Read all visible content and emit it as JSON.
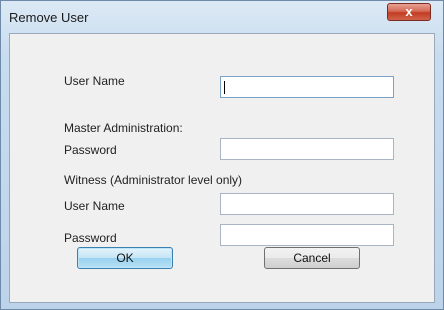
{
  "window": {
    "title": "Remove User",
    "close_glyph": "x"
  },
  "form": {
    "user_name_label": "User Name",
    "user_name_value": "",
    "master_section_label": "Master Administration:",
    "master_password_label": "Password",
    "master_password_value": "",
    "witness_section_label": "Witness (Administrator level only)",
    "witness_user_name_label": "User Name",
    "witness_user_name_value": "",
    "witness_password_label": "Password",
    "witness_password_value": ""
  },
  "buttons": {
    "ok_label": "OK",
    "cancel_label": "Cancel"
  }
}
